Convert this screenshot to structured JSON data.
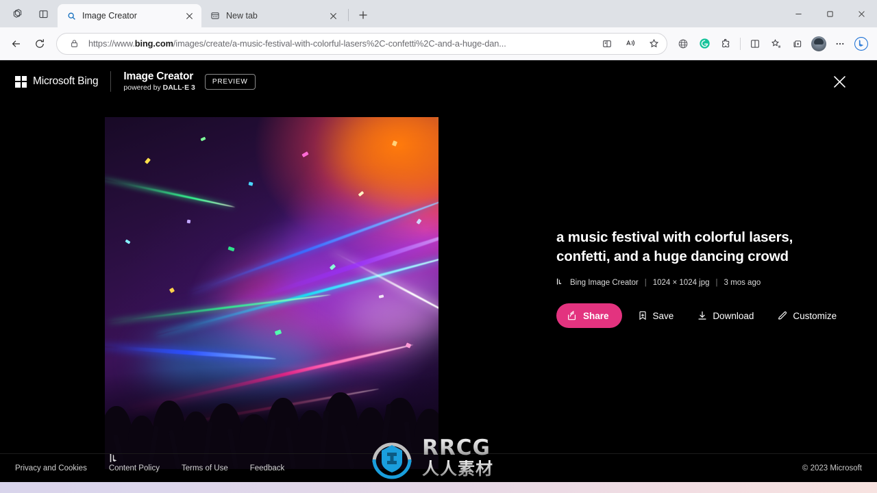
{
  "browser": {
    "sys_icons": [
      {
        "name": "tab-manager-icon",
        "glyph": "copilot-stack"
      },
      {
        "name": "split-workspace-icon",
        "glyph": "workspace"
      }
    ],
    "tabs": [
      {
        "title": "Image Creator",
        "icon": "search-icon",
        "active": true,
        "close": "×"
      },
      {
        "title": "New tab",
        "icon": "newtab-page-icon",
        "active": false,
        "close": "×"
      }
    ],
    "new_tab_label": "+",
    "window_controls": {
      "minimize": "—",
      "maximize": "❐",
      "close": "×"
    },
    "nav": {
      "back_label": "Back",
      "refresh_label": "Refresh"
    },
    "address": {
      "lock_icon": "lock-icon",
      "scheme": "https://www.",
      "host_bold": "bing.com",
      "path": "/images/create/a-music-festival-with-colorful-lasers%2C-confetti%2C-and-a-huge-dan...",
      "full_url": "https://www.bing.com/images/create/a-music-festival-with-colorful-lasers%2C-confetti%2C-and-a-huge-dan...",
      "split_screen_icon": "split-screen-icon",
      "read_aloud_icon": "read-aloud-icon",
      "favorite_icon": "star-icon"
    },
    "toolbar_right": [
      {
        "name": "browser-essentials-icon",
        "glyph": "globe"
      },
      {
        "name": "grammarly-extension-icon",
        "glyph": "G"
      },
      {
        "name": "extensions-icon",
        "glyph": "puzzle"
      },
      {
        "name": "split-screen-icon",
        "glyph": "split"
      },
      {
        "name": "favorites-icon",
        "glyph": "star-list"
      },
      {
        "name": "collections-icon",
        "glyph": "collections"
      },
      {
        "name": "profile-avatar",
        "glyph": "avatar"
      },
      {
        "name": "settings-more-icon",
        "glyph": "..."
      },
      {
        "name": "bing-copilot-icon",
        "glyph": "b"
      }
    ]
  },
  "page": {
    "header": {
      "microsoft_label": "Microsoft Bing",
      "product_title": "Image Creator",
      "product_subtitle_prefix": "powered by ",
      "product_subtitle_brand": "DALL·E 3",
      "preview_badge": "PREVIEW",
      "close_label": "×"
    },
    "detail": {
      "prompt": "a music festival with colorful lasers, confetti, and a huge dancing crowd",
      "meta": {
        "source_icon": "bing-icon",
        "source": "Bing Image Creator",
        "separator": "|",
        "dimensions": "1024 × 1024 jpg",
        "age": "3 mos ago"
      },
      "actions": [
        {
          "name": "share-button",
          "label": "Share",
          "icon": "share-icon",
          "primary": true
        },
        {
          "name": "save-button",
          "label": "Save",
          "icon": "save-icon",
          "primary": false
        },
        {
          "name": "download-button",
          "label": "Download",
          "icon": "download-icon",
          "primary": false
        },
        {
          "name": "customize-button",
          "label": "Customize",
          "icon": "customize-icon",
          "primary": false
        }
      ],
      "image_alt": "a music festival with colorful lasers, confetti, and a huge dancing crowd",
      "image_watermark": "bing-logo-watermark"
    },
    "footer": {
      "links": [
        "Privacy and Cookies",
        "Content Policy",
        "Terms of Use",
        "Feedback"
      ],
      "copyright": "© 2023 Microsoft"
    }
  },
  "overlay_watermark": {
    "brand": "RRCG",
    "brand_cn": "人人素材",
    "logo_color": "#1ba7e8"
  },
  "colors": {
    "accent_pink": "#e3337f",
    "page_bg": "#000000",
    "tabstrip_bg": "#dee1e6",
    "navbar_bg": "#f9f9fb"
  }
}
